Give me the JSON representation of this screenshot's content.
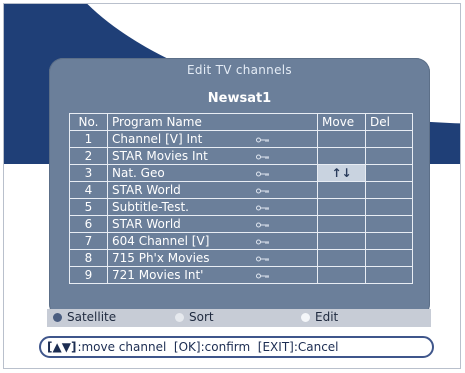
{
  "panel": {
    "title": "Edit TV channels",
    "satellite": "Newsat1"
  },
  "table": {
    "headers": [
      "No.",
      "Program Name",
      "Move",
      "Del"
    ],
    "rows": [
      {
        "no": "1",
        "name": "Channel [V] Int",
        "locked": true,
        "move": ""
      },
      {
        "no": "2",
        "name": "STAR Movies Int",
        "locked": true,
        "move": ""
      },
      {
        "no": "3",
        "name": "Nat. Geo",
        "locked": true,
        "move": "↑↓"
      },
      {
        "no": "4",
        "name": "STAR World",
        "locked": true,
        "move": ""
      },
      {
        "no": "5",
        "name": "Subtitle-Test.",
        "locked": true,
        "move": ""
      },
      {
        "no": "6",
        "name": "STAR World",
        "locked": true,
        "move": ""
      },
      {
        "no": "7",
        "name": "604 Channel [V]",
        "locked": true,
        "move": ""
      },
      {
        "no": "8",
        "name": "715 Ph'x Movies",
        "locked": true,
        "move": ""
      },
      {
        "no": "9",
        "name": "721 Movies Int'",
        "locked": true,
        "move": ""
      }
    ]
  },
  "options": {
    "satellite": {
      "label": "Satellite",
      "color": "#4a5d80"
    },
    "sort": {
      "label": "Sort",
      "color": "#e6e9ee"
    },
    "edit": {
      "label": "Edit",
      "color": "#f4f6f9"
    }
  },
  "help": {
    "symbol": "[▲▼]",
    "text": ":move channel  [OK]:confirm  [EXIT]:Cancel"
  },
  "icons": {
    "lock": "key-icon",
    "move": "move-arrows-icon"
  }
}
